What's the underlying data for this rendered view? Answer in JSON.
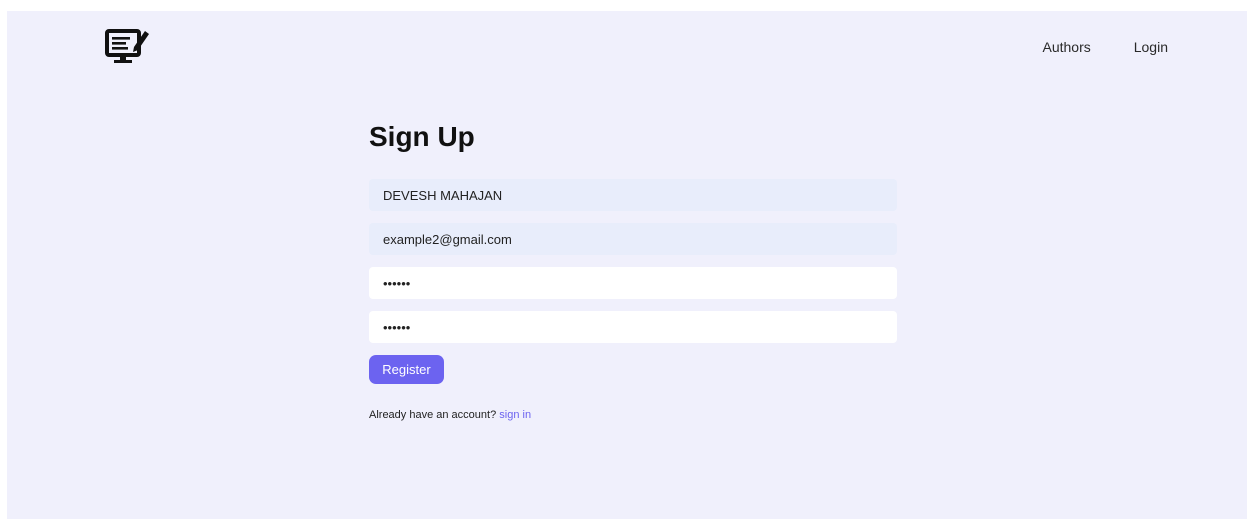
{
  "nav": {
    "logo_icon": "monitor-with-pen-icon",
    "links": [
      {
        "label": "Authors"
      },
      {
        "label": "Login"
      }
    ]
  },
  "form": {
    "title": "Sign Up",
    "name_value": "DEVESH MAHAJAN",
    "email_value": "example2@gmail.com",
    "password_value": "••••••",
    "confirm_password_value": "••••••",
    "register_label": "Register",
    "signin_prompt": "Already have an account?",
    "signin_link": "sign in"
  },
  "colors": {
    "background": "#f0f0fc",
    "accent": "#6c63f0",
    "filled_input": "#e8edfb",
    "empty_input": "#ffffff"
  }
}
